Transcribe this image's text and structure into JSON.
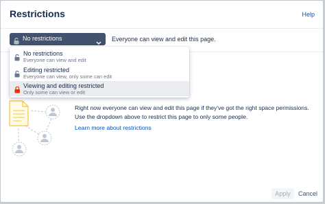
{
  "dialog": {
    "title": "Restrictions",
    "help_label": "Help"
  },
  "select": {
    "selected_label": "No restrictions",
    "selected_description": "Everyone can view and edit this page."
  },
  "menu": {
    "options": [
      {
        "title": "No restrictions",
        "subtitle": "Everyone can view and edit",
        "icon": "unlocked-icon"
      },
      {
        "title": "Editing restricted",
        "subtitle": "Everyone can view, only some can edit",
        "icon": "unlocked-icon"
      },
      {
        "title": "Viewing and editing restricted",
        "subtitle": "Only some can view or edit",
        "icon": "lock-icon"
      }
    ],
    "highlighted_index": 2
  },
  "info": {
    "line1": "Right now everyone can view and edit this page if they've got the right space permissions.",
    "line2": "Use the dropdown above to restrict this page to only some people.",
    "learn_more": "Learn more about restrictions"
  },
  "footer": {
    "apply_label": "Apply",
    "cancel_label": "Cancel"
  },
  "colors": {
    "select_bg": "#42526e",
    "link": "#0052cc",
    "lock_red": "#de350b",
    "illustration_orange": "#f6c342"
  }
}
